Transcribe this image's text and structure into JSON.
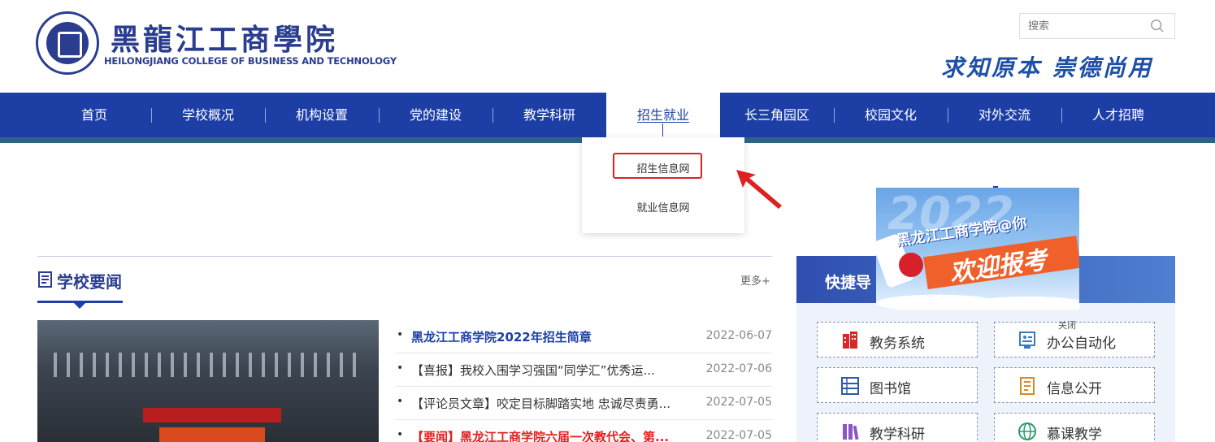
{
  "header": {
    "logo_cn": "黑龍江工商學院",
    "logo_en": "HEILONGJIANG COLLEGE OF BUSINESS AND TECHNOLOGY",
    "search_placeholder": "搜索",
    "motto": "求知原本 崇德尚用"
  },
  "nav": {
    "items": [
      "首页",
      "学校概况",
      "机构设置",
      "党的建设",
      "教学科研",
      "招生就业",
      "长三角园区",
      "校园文化",
      "对外交流",
      "人才招聘"
    ],
    "active_index": 5,
    "dropdown": [
      "招生信息网",
      "就业信息网"
    ],
    "highlighted_dropdown": "招生信息网"
  },
  "news": {
    "title": "学校要闻",
    "more": "更多+",
    "items": [
      {
        "title": "黑龙江工商学院2022年招生简章",
        "date": "2022-06-07",
        "style": "bold"
      },
      {
        "title": "【喜报】我校入围学习强国“同学汇”优秀运...",
        "date": "2022-07-06",
        "style": "normal"
      },
      {
        "title": "【评论员文章】咬定目标脚踏实地 忠诚尽责勇...",
        "date": "2022-07-05",
        "style": "normal"
      },
      {
        "title": "【要闻】黑龙江工商学院六届一次教代会、第...",
        "date": "2022-07-05",
        "style": "red"
      }
    ]
  },
  "quick": {
    "title": "快捷导",
    "buttons": [
      {
        "label": "教务系统",
        "icon": "building-icon"
      },
      {
        "label": "办公自动化",
        "icon": "office-icon"
      },
      {
        "label": "图书馆",
        "icon": "library-icon"
      },
      {
        "label": "信息公开",
        "icon": "document-icon"
      },
      {
        "label": "教学科研",
        "icon": "books-icon"
      },
      {
        "label": "慕课教学",
        "icon": "globe-icon"
      }
    ]
  },
  "popup": {
    "line1": "黑龙江工商学院@你",
    "line2": "欢迎报考",
    "close": "关闭"
  },
  "colors": {
    "nav_bg": "#1d3fa5",
    "brand": "#2a3d8f",
    "highlight": "#e02020"
  }
}
